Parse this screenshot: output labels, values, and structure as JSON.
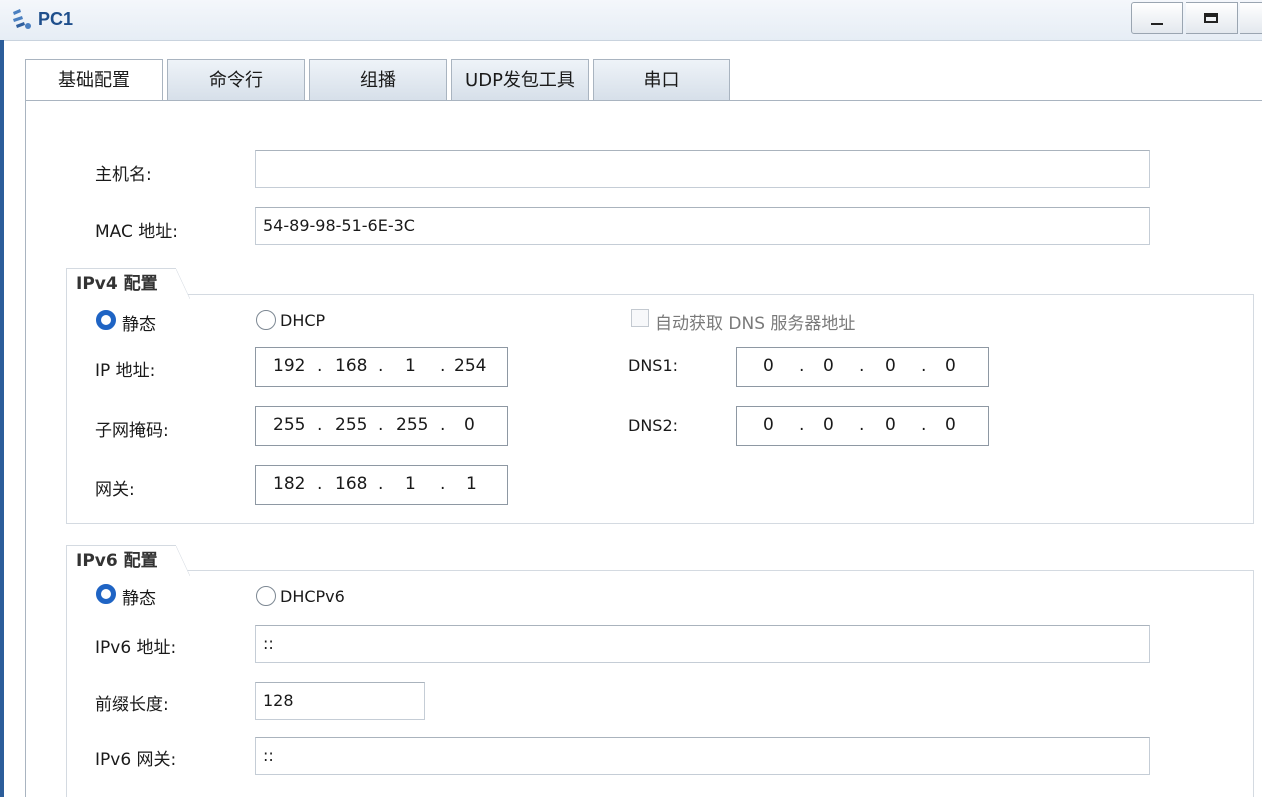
{
  "window": {
    "title": "PC1"
  },
  "tabs": [
    {
      "label": "基础配置",
      "active": true
    },
    {
      "label": "命令行",
      "active": false
    },
    {
      "label": "组播",
      "active": false
    },
    {
      "label": "UDP发包工具",
      "active": false
    },
    {
      "label": "串口",
      "active": false
    }
  ],
  "basic": {
    "hostname_label": "主机名:",
    "hostname_value": "",
    "mac_label": "MAC 地址:",
    "mac_value": "54-89-98-51-6E-3C"
  },
  "ipv4": {
    "group_title": "IPv4 配置",
    "static_label": "静态",
    "dhcp_label": "DHCP",
    "mode": "static",
    "auto_dns_label": "自动获取 DNS 服务器地址",
    "auto_dns_checked": false,
    "ip_label": "IP 地址:",
    "ip": [
      "192",
      "168",
      "1",
      "254"
    ],
    "mask_label": "子网掩码:",
    "mask": [
      "255",
      "255",
      "255",
      "0"
    ],
    "gateway_label": "网关:",
    "gateway": [
      "182",
      "168",
      "1",
      "1"
    ],
    "dns1_label": "DNS1:",
    "dns1": [
      "0",
      "0",
      "0",
      "0"
    ],
    "dns2_label": "DNS2:",
    "dns2": [
      "0",
      "0",
      "0",
      "0"
    ]
  },
  "ipv6": {
    "group_title": "IPv6 配置",
    "static_label": "静态",
    "dhcp_label": "DHCPv6",
    "mode": "static",
    "addr_label": "IPv6 地址:",
    "addr_value": "::",
    "prefix_label": "前缀长度:",
    "prefix_value": "128",
    "gateway_label": "IPv6 网关:",
    "gateway_value": "::"
  },
  "colors": {
    "accent": "#1f64c4",
    "title": "#1f4f8c"
  },
  "icons": {
    "app": "ensp-pc-icon",
    "minimize": "minimize-icon",
    "maximize": "maximize-icon"
  }
}
